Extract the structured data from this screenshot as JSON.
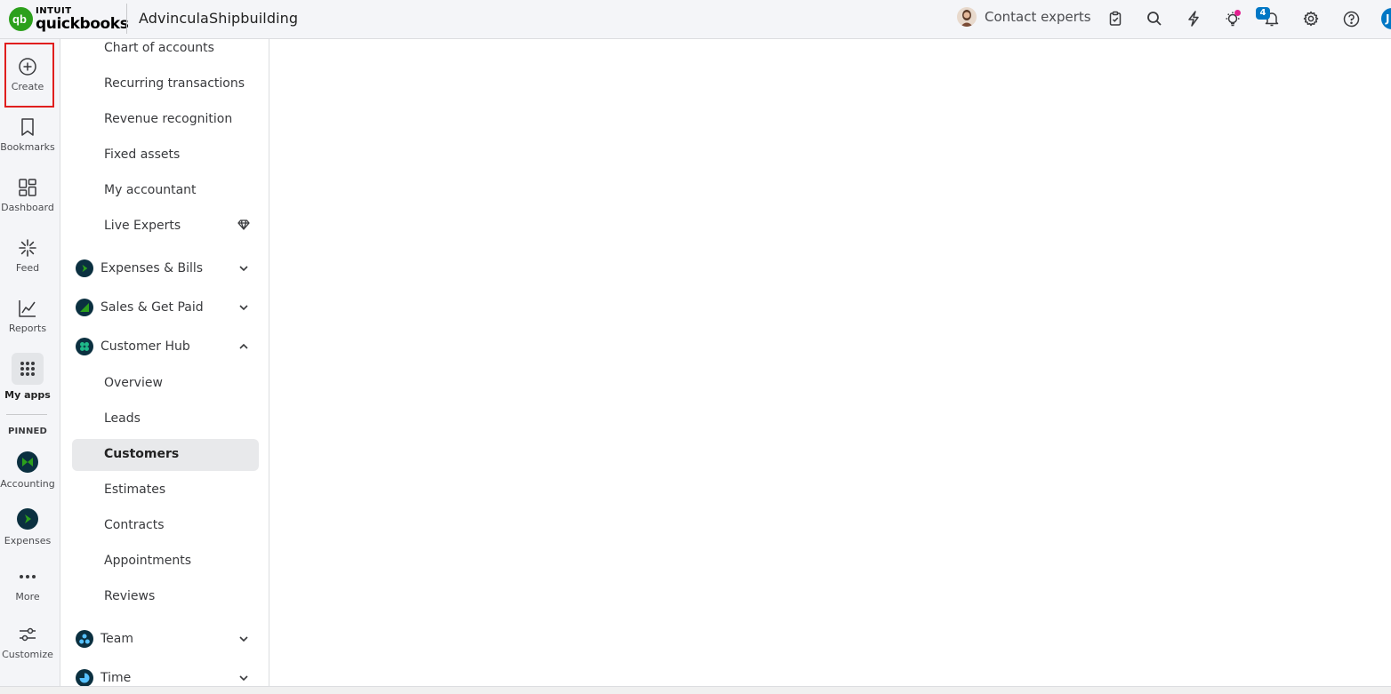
{
  "app": {
    "brand_top": "INTUIT",
    "brand_name": "quickbooks",
    "company_name": "AdvinculaShipbuilding"
  },
  "topbar": {
    "contact_label": "Contact experts",
    "notifications_count": "4",
    "user_initial": "J",
    "icons": [
      "clipboard-icon",
      "search-icon",
      "lightning-icon",
      "lightbulb-icon",
      "bell-icon",
      "gear-icon",
      "help-icon"
    ]
  },
  "rail": {
    "create": "Create",
    "bookmarks": "Bookmarks",
    "dashboard": "Dashboard",
    "feed": "Feed",
    "reports": "Reports",
    "my_apps": "My apps",
    "pinned": "PINNED",
    "accounting": "Accounting",
    "expenses": "Expenses",
    "more": "More",
    "customize": "Customize"
  },
  "subnav": {
    "accounting_links": [
      "Chart of accounts",
      "Recurring transactions",
      "Revenue recognition",
      "Fixed assets",
      "My accountant",
      "Live Experts"
    ],
    "groups": {
      "expenses_bills": "Expenses & Bills",
      "sales_get_paid": "Sales & Get Paid",
      "customer_hub": "Customer Hub",
      "team": "Team",
      "time": "Time"
    },
    "customer_hub_links": [
      "Overview",
      "Leads",
      "Customers",
      "Estimates",
      "Contracts",
      "Appointments",
      "Reviews"
    ],
    "active_item": "Customers"
  },
  "colors": {
    "brand_green": "#2ca01c",
    "app_dot": "#0b3040",
    "accent_blue": "#0077c5",
    "highlight_red": "#e01e1e"
  }
}
